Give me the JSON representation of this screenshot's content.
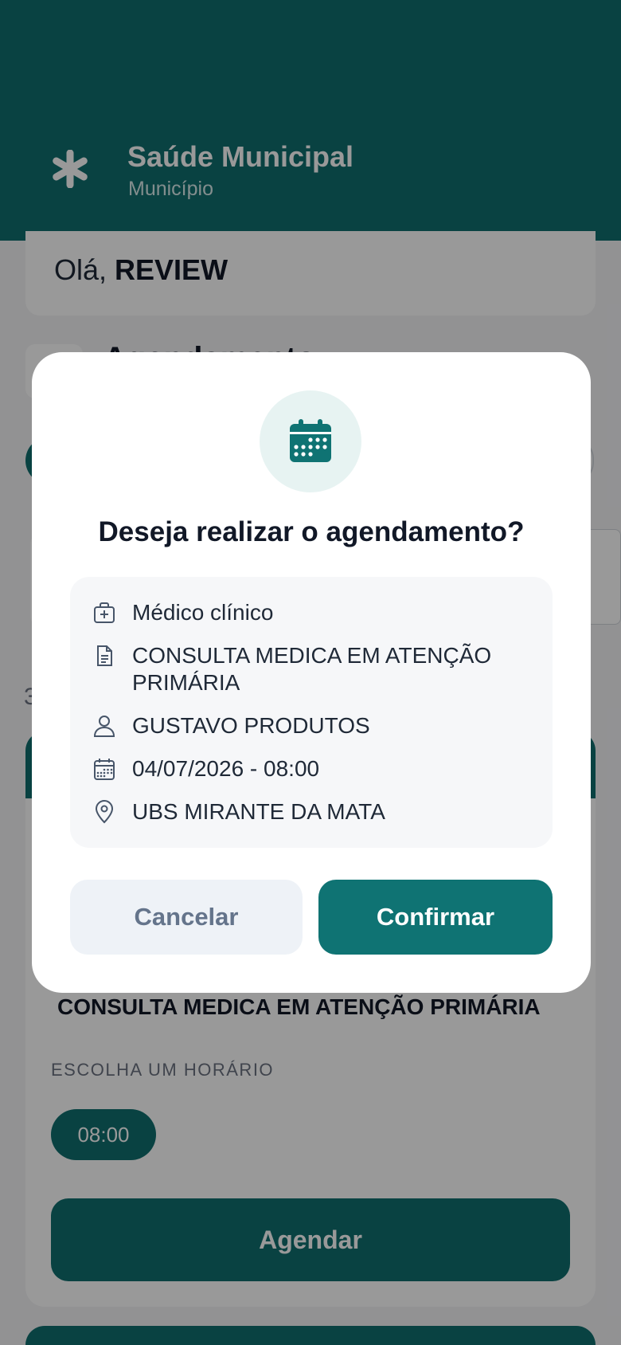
{
  "header": {
    "brand_title": "Saúde Municipal",
    "brand_subtitle": "Município"
  },
  "greeting": {
    "prefix": "Olá, ",
    "name": "REVIEW"
  },
  "section": {
    "title": "Agendamento"
  },
  "results": {
    "count_text": "3",
    "procedure_name": "CONSULTA MEDICA EM ATENÇÃO PRIMÁRIA",
    "choose_time_label": "ESCOLHA UM HORÁRIO",
    "time_slot": "08:00",
    "schedule_button": "Agendar"
  },
  "modal": {
    "title": "Deseja realizar o agendamento?",
    "details": {
      "specialty": "Médico clínico",
      "procedure": "CONSULTA MEDICA EM ATENÇÃO PRIMÁRIA",
      "professional": "GUSTAVO PRODUTOS",
      "datetime": "04/07/2026 - 08:00",
      "location": "UBS MIRANTE DA MATA"
    },
    "cancel_label": "Cancelar",
    "confirm_label": "Confirmar"
  },
  "colors": {
    "primary": "#0f6e6e",
    "overlay": "rgba(0,0,0,0.40)",
    "light_bg": "#f6f7f9"
  },
  "icons": {
    "logo": "asterisk-icon",
    "modal": "calendar-icon",
    "specialty": "medical-bag-icon",
    "procedure": "document-icon",
    "professional": "user-icon",
    "datetime": "calendar-icon",
    "location": "map-pin-icon"
  }
}
